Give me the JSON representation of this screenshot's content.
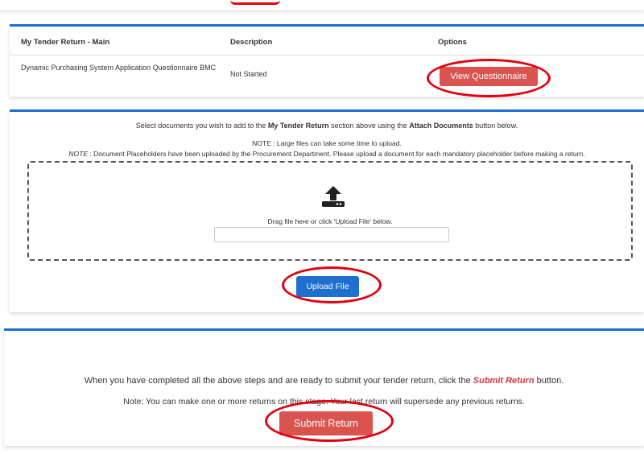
{
  "colors": {
    "accent_blue": "#1f6fcf",
    "button_red": "#d9534f",
    "annotation_red": "#e3000f"
  },
  "tender_table": {
    "headers": [
      "My Tender Return - Main",
      "Description",
      "Options"
    ],
    "rows": [
      {
        "title": "Dynamic Purchasing System Application Questionnaire BMC",
        "description": "Not Started",
        "action_label": "View Questionnaire"
      }
    ]
  },
  "upload": {
    "instruction_pre": "Select documents you wish to add to the ",
    "instruction_bold1": "My Tender Return",
    "instruction_mid": " section above using the ",
    "instruction_bold2": "Attach Documents",
    "instruction_post": " button below.",
    "note_large_files": "NOTE : Large files can take some time to upload.",
    "note_label": "NOTE",
    "note_placeholders": " : Document Placeholders have been uploaded by the Procurement Department. Please upload a document for each mandatory placeholder before making a return.",
    "drag_text": "Drag file here or click 'Upload File' below.",
    "icon": "upload-icon",
    "button_label": "Upload File"
  },
  "submit": {
    "line1_pre": "When you have completed all the above steps and are ready to submit your tender return, click the ",
    "line1_emph": "Submit Return",
    "line1_post": " button.",
    "line2": "Note: You can make one or more returns on this stage. Your last return will supersede any previous returns.",
    "button_label": "Submit Return"
  }
}
